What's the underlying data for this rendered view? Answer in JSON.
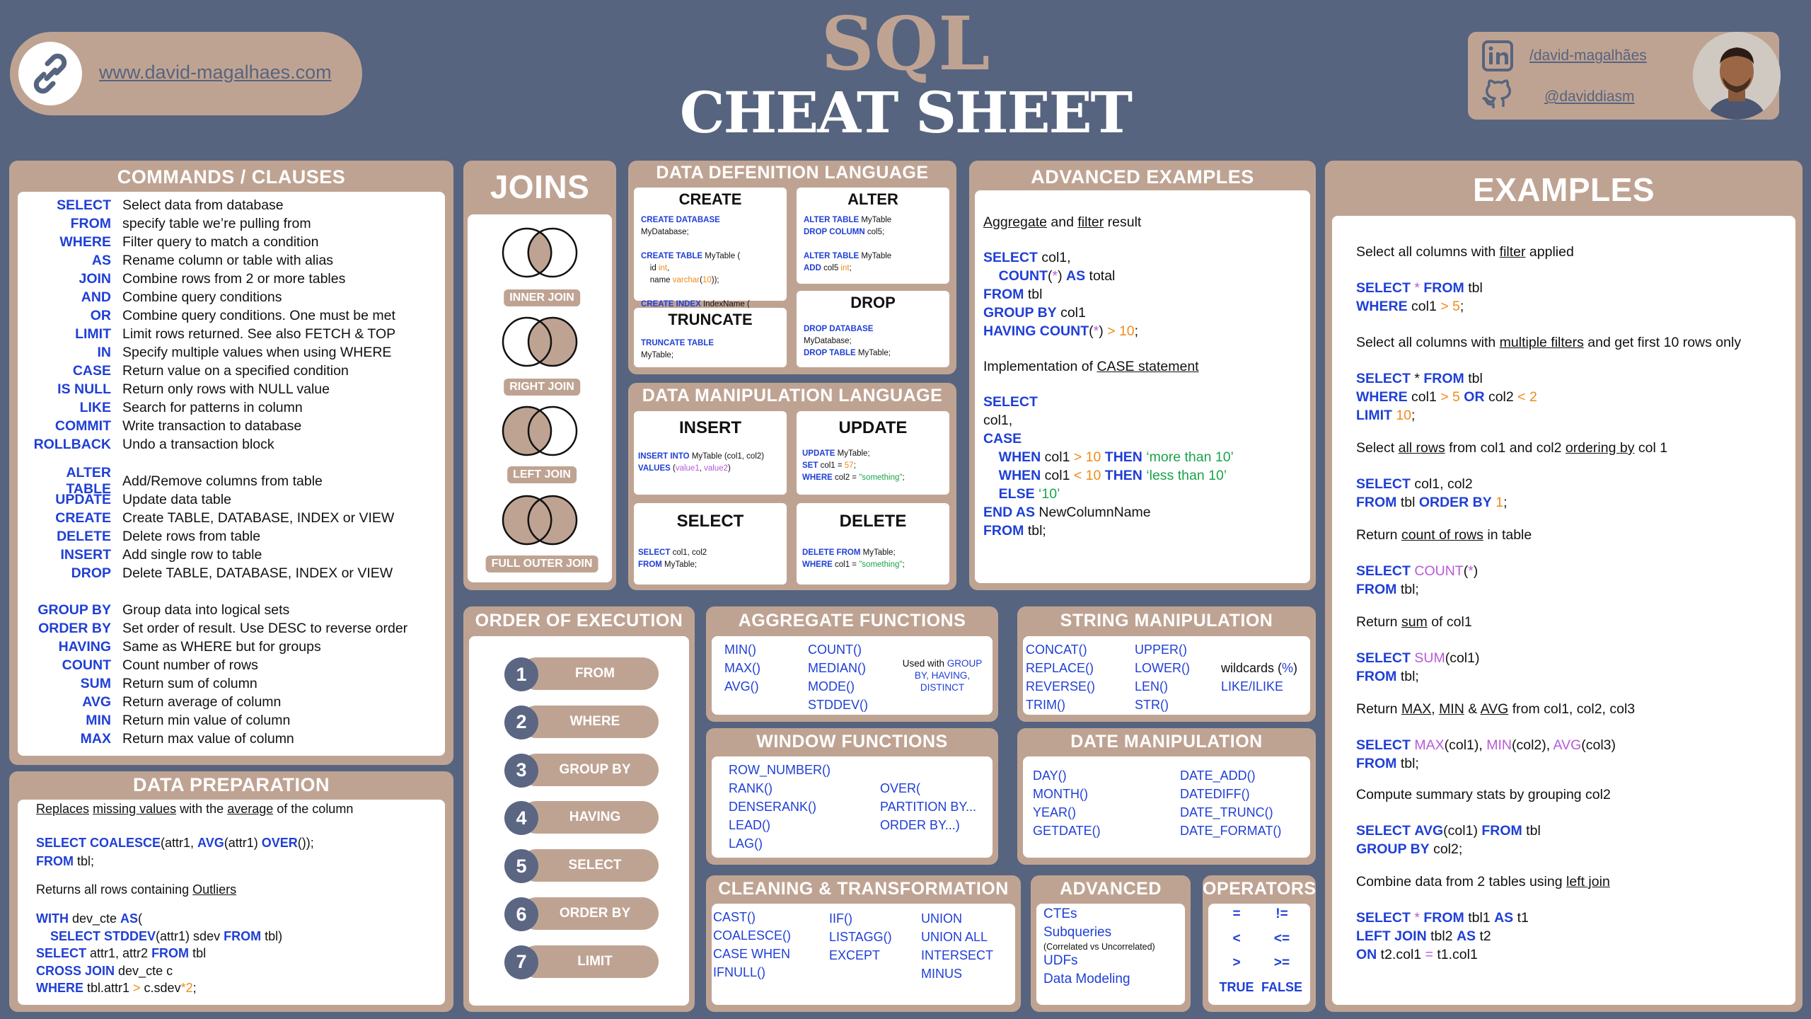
{
  "header": {
    "website": "www.david-magalhaes.com",
    "title_top": "SQL",
    "title_bottom": "CHEAT SHEET",
    "linkedin": "/david-magalhães",
    "github": "@daviddiasm"
  },
  "commands": {
    "title": "COMMANDS / CLAUSES",
    "group1": [
      {
        "k": "SELECT",
        "d": "Select data from database"
      },
      {
        "k": "FROM",
        "d": "specify table we’re pulling from"
      },
      {
        "k": "WHERE",
        "d": "Filter query to match a condition"
      },
      {
        "k": "AS",
        "d": "Rename column or table with alias"
      },
      {
        "k": "JOIN",
        "d": "Combine rows from 2 or more tables"
      },
      {
        "k": "AND",
        "d": "Combine query conditions"
      },
      {
        "k": "OR",
        "d": "Combine query conditions. One must be met"
      },
      {
        "k": "LIMIT",
        "d": "Limit rows returned. See also FETCH & TOP"
      },
      {
        "k": "IN",
        "d": "Specify multiple values when using WHERE"
      },
      {
        "k": "CASE",
        "d": "Return value on a specified condition"
      },
      {
        "k": "IS NULL",
        "d": "Return only rows with NULL value"
      },
      {
        "k": "LIKE",
        "d": "Search for patterns in column"
      },
      {
        "k": "COMMIT",
        "d": "Write transaction to database"
      },
      {
        "k": "ROLLBACK",
        "d": "Undo a transaction block"
      }
    ],
    "group2": [
      {
        "k": "ALTER TABLE",
        "d": "Add/Remove columns from table"
      },
      {
        "k": "UPDATE",
        "d": "Update data table"
      },
      {
        "k": "CREATE",
        "d": "Create TABLE, DATABASE, INDEX or VIEW"
      },
      {
        "k": "DELETE",
        "d": "Delete rows from table"
      },
      {
        "k": "INSERT",
        "d": "Add single row to table"
      },
      {
        "k": "DROP",
        "d": "Delete TABLE, DATABASE, INDEX or VIEW"
      }
    ],
    "group3": [
      {
        "k": "GROUP BY",
        "d": "Group data into logical sets"
      },
      {
        "k": "ORDER BY",
        "d": "Set order of result. Use DESC to reverse order"
      },
      {
        "k": "HAVING",
        "d": "Same as WHERE but for groups"
      },
      {
        "k": "COUNT",
        "d": "Count number of rows"
      },
      {
        "k": "SUM",
        "d": "Return sum of column"
      },
      {
        "k": "AVG",
        "d": "Return average of column"
      },
      {
        "k": "MIN",
        "d": "Return min value of column"
      },
      {
        "k": "MAX",
        "d": "Return max value of column"
      }
    ]
  },
  "data_prep": {
    "title": "DATA PREPARATION",
    "desc1_pre": "Replaces",
    "desc1_a": "missing values",
    "desc1_b": "with the",
    "desc1_c": "average",
    "desc1_d": "of the column",
    "desc2_pre": "Returns all rows containing",
    "desc2_a": "Outliers"
  },
  "joins": {
    "title": "JOINS",
    "items": [
      "INNER JOIN",
      "RIGHT JOIN",
      "LEFT JOIN",
      "FULL OUTER JOIN"
    ]
  },
  "ddl": {
    "title": "DATA DEFENITION LANGUAGE",
    "create": "CREATE",
    "alter": "ALTER",
    "truncate": "TRUNCATE",
    "drop": "DROP"
  },
  "dml": {
    "title": "DATA MANIPULATION LANGUAGE",
    "insert": "INSERT",
    "update": "UPDATE",
    "select": "SELECT",
    "delete": "DELETE"
  },
  "advanced_examples": {
    "title": "ADVANCED EXAMPLES",
    "desc1_a": "Aggregate",
    "desc1_b": "and",
    "desc1_c": "filter",
    "desc1_d": "result",
    "desc2_a": "Implementation of",
    "desc2_b": "CASE statement"
  },
  "examples": {
    "title": "EXAMPLES"
  },
  "order_exec": {
    "title": "ORDER OF EXECUTION",
    "steps": [
      {
        "n": "1",
        "label": "FROM"
      },
      {
        "n": "2",
        "label": "WHERE"
      },
      {
        "n": "3",
        "label": "GROUP BY"
      },
      {
        "n": "4",
        "label": "HAVING"
      },
      {
        "n": "5",
        "label": "SELECT"
      },
      {
        "n": "6",
        "label": "ORDER BY"
      },
      {
        "n": "7",
        "label": "LIMIT"
      }
    ]
  },
  "aggregate": {
    "title": "AGGREGATE FUNCTIONS",
    "col1": [
      "MIN()",
      "MAX()",
      "AVG()"
    ],
    "col2": [
      "COUNT()",
      "MEDIAN()",
      "MODE()",
      "STDDEV()"
    ],
    "note_a": "Used with",
    "note_b": "GROUP BY, HAVING, DISTINCT"
  },
  "string": {
    "title": "STRING MANIPULATION",
    "col1": [
      "CONCAT()",
      "REPLACE()",
      "REVERSE()",
      "TRIM()"
    ],
    "col2": [
      "UPPER()",
      "LOWER()",
      "LEN()",
      "STR()"
    ],
    "wild_a": "wildcards (",
    "wild_b": "%",
    "wild_c": ")",
    "like": "LIKE/ILIKE"
  },
  "window": {
    "title": "WINDOW FUNCTIONS",
    "col1": [
      "ROW_NUMBER()",
      "RANK()",
      "DENSERANK()",
      "LEAD()",
      "LAG()"
    ],
    "col2": [
      "OVER(",
      "PARTITION BY...",
      "ORDER BY...)"
    ]
  },
  "date": {
    "title": "DATE MANIPULATION",
    "col1": [
      "DAY()",
      "MONTH()",
      "YEAR()",
      "GETDATE()"
    ],
    "col2": [
      "DATE_ADD()",
      "DATEDIFF()",
      "DATE_TRUNC()",
      "DATE_FORMAT()"
    ]
  },
  "cleaning": {
    "title": "CLEANING & TRANSFORMATION",
    "col1": [
      "CAST()",
      "COALESCE()",
      "CASE WHEN",
      "IFNULL()"
    ],
    "col2": [
      "IIF()",
      "LISTAGG()",
      "EXCEPT"
    ],
    "col3": [
      "UNION",
      "UNION ALL",
      "INTERSECT",
      "MINUS"
    ]
  },
  "advanced": {
    "title": "ADVANCED",
    "items": [
      "CTEs",
      "Subqueries",
      "(Correlated vs Uncorrelated)",
      "UDFs",
      "Data Modeling"
    ]
  },
  "operators": {
    "title": "OPERATORS",
    "items": [
      "=",
      "!=",
      "<",
      "<=",
      ">",
      ">=",
      "TRUE",
      "FALSE"
    ]
  }
}
